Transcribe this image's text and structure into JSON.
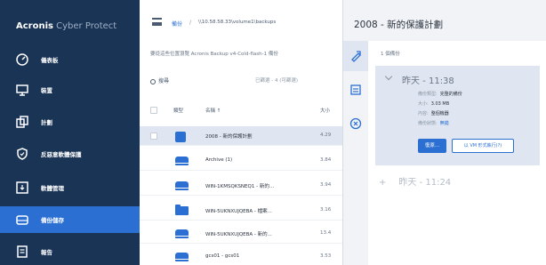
{
  "sidebar": {
    "logo_bold": "Acronis",
    "logo_light": "Cyber Protect",
    "items": [
      {
        "label": "儀表板",
        "icon": "gauge-icon"
      },
      {
        "label": "裝置",
        "icon": "monitor-icon"
      },
      {
        "label": "計劃",
        "icon": "plans-icon"
      },
      {
        "label": "反惡意軟體保護",
        "icon": "shield-icon"
      },
      {
        "label": "軟體管理",
        "icon": "software-icon"
      },
      {
        "label": "備份儲存",
        "icon": "storage-icon"
      },
      {
        "label": "報告",
        "icon": "reports-icon"
      }
    ],
    "active_index": 5
  },
  "middle": {
    "breadcrumb_root": "備份",
    "breadcrumb_sep": "/",
    "breadcrumb_path": "\\\\10.58.58.33\\volume1\\backups",
    "subtitle": "要從這些位置瀏覽 Acronis Backup v4-Cold-flash-1 備份",
    "search_label": "搜尋",
    "filter_label": "已篩選 - 4 (可篩選)",
    "columns": {
      "type": "類型",
      "name": "名稱 ↑",
      "size": "大小"
    },
    "rows": [
      {
        "icon": "plan-icon",
        "name": "2008 - 新的保護計劃",
        "size": "4.29",
        "selected": true
      },
      {
        "icon": "drive-icon",
        "name": "Archive (1)",
        "size": "3.84",
        "selected": false
      },
      {
        "icon": "drive-icon",
        "name": "WIN-1KMSQKSNEQ1 - 新的...",
        "size": "3.94",
        "selected": false
      },
      {
        "icon": "folder-icon",
        "name": "WIN-5UKNXUJQEBA - 檔案...",
        "size": "3.16",
        "selected": false
      },
      {
        "icon": "drive-icon",
        "name": "WIN-5UKNXUJQEBA - 新的...",
        "size": "13.4",
        "selected": false
      },
      {
        "icon": "drive-icon",
        "name": "gcs01 - gcs01",
        "size": "3.53",
        "selected": false
      }
    ]
  },
  "right": {
    "title": "2008 - 新的保護計劃",
    "section_label": "1 個備份",
    "card": {
      "header": "昨天 - 11:38",
      "fields": [
        {
          "key": "備份類型:",
          "value": "完整的備份",
          "blue": false
        },
        {
          "key": "大小:",
          "value": "3.03 MB",
          "blue": false
        },
        {
          "key": "內容:",
          "value": "整個機器",
          "blue": false
        },
        {
          "key": "備份狀態:",
          "value": "無錯",
          "blue": true
        }
      ],
      "recover_button": "復原...",
      "secondary_button": "以 VM 形式執行(?)"
    },
    "collapsed": {
      "plus": "+",
      "label": "昨天 - 11:24"
    },
    "tab_icons": [
      "archive-tab-icon",
      "details-tab-icon",
      "info-tab-icon"
    ]
  }
}
